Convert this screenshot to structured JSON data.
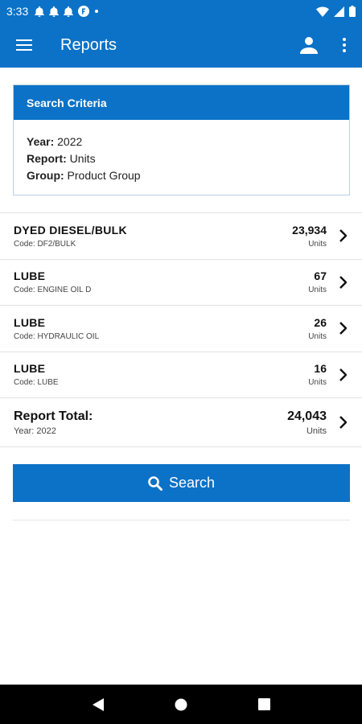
{
  "status_bar": {
    "time": "3:33",
    "icons": [
      "bell-icon",
      "bell-icon",
      "bell-icon",
      "app-notification-icon",
      "dot-icon",
      "wifi-icon",
      "signal-icon",
      "battery-icon"
    ]
  },
  "app_bar": {
    "title": "Reports",
    "icons": [
      "menu-icon",
      "account-icon",
      "more-vert-icon"
    ]
  },
  "criteria": {
    "header": "Search Criteria",
    "year_label": "Year:",
    "year_value": "2022",
    "report_label": "Report:",
    "report_value": "Units",
    "group_label": "Group:",
    "group_value": "Product Group"
  },
  "rows": [
    {
      "name": "DYED DIESEL/BULK",
      "code": "Code: DF2/BULK",
      "value": "23,934",
      "unit": "Units"
    },
    {
      "name": "LUBE",
      "code": "Code: ENGINE OIL D",
      "value": "67",
      "unit": "Units"
    },
    {
      "name": "LUBE",
      "code": "Code: HYDRAULIC OIL",
      "value": "26",
      "unit": "Units"
    },
    {
      "name": "LUBE",
      "code": "Code: LUBE",
      "value": "16",
      "unit": "Units"
    }
  ],
  "total": {
    "label": "Report Total:",
    "sub": "Year: 2022",
    "value": "24,043",
    "unit": "Units"
  },
  "search_button": {
    "label": "Search"
  },
  "colors": {
    "primary": "#0b72c7",
    "divider": "#e2e2e2",
    "nav": "#000000"
  }
}
